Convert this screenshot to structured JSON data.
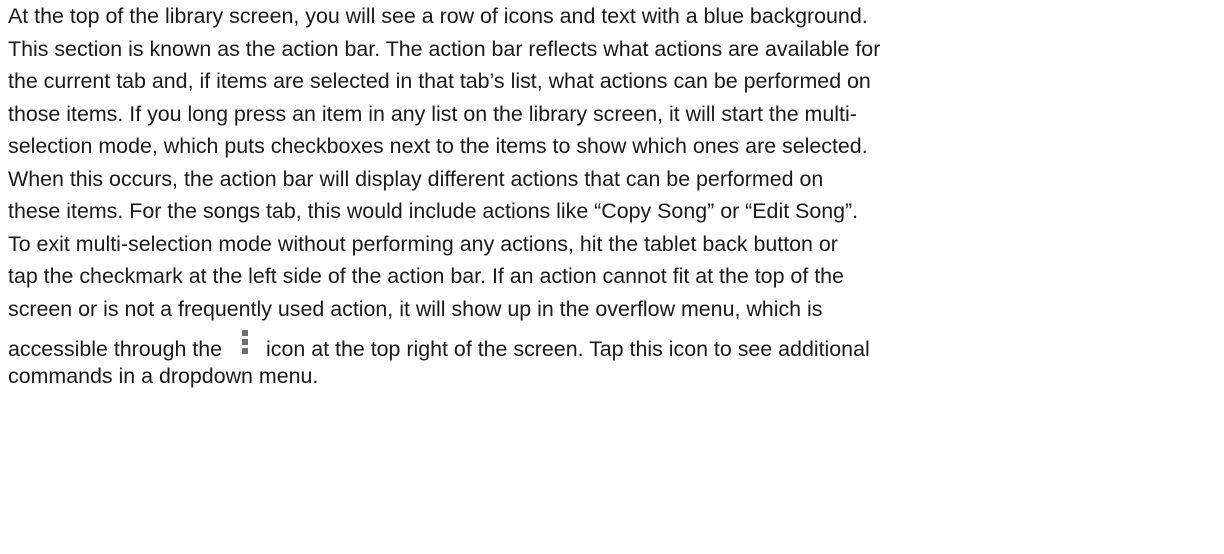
{
  "paragraph": {
    "lines": [
      "At the top of the library screen, you will see a row of icons and text with a blue background.",
      "This section is known as the action bar. The action bar reflects what actions are available for",
      "the current tab and, if items are selected in that tab’s list, what actions can be performed on",
      "those items. If you long press an item in any list on the library screen, it will start the multi-",
      "selection mode, which puts checkboxes next to the items to show which ones are selected.",
      "When this occurs, the action bar will display different actions that can be performed on",
      "these items. For the songs tab, this would include actions like “Copy Song” or “Edit Song”.",
      "To exit multi-selection mode without performing any actions, hit the tablet back button or",
      "tap the checkmark at the left side of the action bar. If an action cannot fit at the top of the",
      "screen or is not a frequently used action, it will show up in the overflow menu, which is"
    ],
    "line11_before_icon": "accessible through the",
    "icon": "overflow-menu-icon",
    "line11_after_icon": "icon at the top right of the screen. Tap this icon to see additional",
    "line12": "commands in a dropdown menu."
  }
}
